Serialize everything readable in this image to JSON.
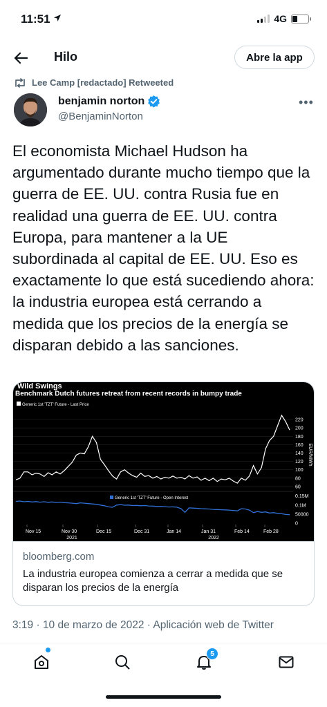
{
  "status_bar": {
    "time": "11:51",
    "network": "4G"
  },
  "header": {
    "title": "Hilo",
    "open_app_label": "Abre la app"
  },
  "retweet": {
    "text": "Lee Camp [redactado] Retweeted"
  },
  "author": {
    "name": "benjamin norton",
    "handle": "@BenjaminNorton",
    "verified": true
  },
  "tweet": {
    "text": "El economista Michael Hudson ha argumentado durante mucho tiempo que la guerra de EE. UU. contra Rusia fue en realidad una guerra de EE. UU. contra Europa, para mantener a la UE subordinada al capital de EE. UU. Eso es exactamente lo que está sucediendo ahora: la industria europea está cerrando a medida que los precios de la energía se disparan debido a las sanciones.",
    "meta": "3:19 · 10 de marzo de 2022 · Aplicación web de Twitter"
  },
  "card": {
    "domain": "bloomberg.com",
    "title": "La industria europea comienza a cerrar a medida que se disparan los precios de la energía"
  },
  "nav": {
    "notification_count": "5"
  },
  "colors": {
    "accent": "#1d9bf0",
    "open_interest_line": "#2f6fd6"
  },
  "chart_data": {
    "type": "line",
    "title": "Wild Swings",
    "subtitle": "Benchmark Dutch futures retreat from recent records in bumpy trade",
    "top_panel": {
      "legend": "Generic 1st 'TZT' Future - Last Price",
      "ylabel": "EUR/MWh",
      "y_ticks": [
        "220",
        "200",
        "180",
        "160",
        "140",
        "120",
        "100",
        "80",
        "60"
      ],
      "ylim": [
        55,
        230
      ],
      "values": [
        76,
        80,
        95,
        95,
        88,
        92,
        90,
        84,
        93,
        88,
        95,
        90,
        98,
        108,
        118,
        135,
        140,
        138,
        155,
        180,
        165,
        125,
        112,
        98,
        85,
        78,
        95,
        100,
        92,
        86,
        82,
        92,
        84,
        86,
        80,
        84,
        78,
        82,
        80,
        85,
        80,
        82,
        78,
        86,
        80,
        83,
        75,
        80,
        74,
        80,
        72,
        78,
        76,
        80,
        73,
        68,
        80,
        75,
        85,
        110,
        90,
        105,
        150,
        170,
        180,
        205,
        230,
        215,
        195
      ]
    },
    "bottom_panel": {
      "legend": "Generic 1st 'TZT' Future - Open Interest",
      "y_ticks": [
        "0.15M",
        "0.1M",
        "50000",
        "0"
      ],
      "ylim": [
        0,
        160000
      ],
      "values": [
        120000,
        122000,
        118000,
        120000,
        117000,
        119000,
        116000,
        118000,
        115000,
        117000,
        114000,
        116000,
        113000,
        112000,
        110000,
        108000,
        112000,
        110000,
        108000,
        106000,
        104000,
        100000,
        96000,
        90000,
        88000,
        100000,
        102000,
        99000,
        100000,
        97000,
        98000,
        96000,
        97000,
        95000,
        94000,
        92000,
        93000,
        91000,
        89000,
        90000,
        88000,
        80000,
        60000,
        84000,
        83000,
        82000,
        80000,
        79000,
        78000,
        76000,
        75000,
        74000,
        73000,
        72000,
        70000,
        68000,
        80000,
        78000,
        72000,
        58000,
        64000,
        60000,
        62000,
        56000,
        58000,
        54000,
        52000,
        48000,
        47000
      ]
    },
    "x_ticks": [
      "Nov 15",
      "Nov 30",
      "Dec 15",
      "Dec 31",
      "Jan 14",
      "Jan 31",
      "Feb 14",
      "Feb 28"
    ],
    "x_years": [
      "2021",
      "2022"
    ]
  }
}
